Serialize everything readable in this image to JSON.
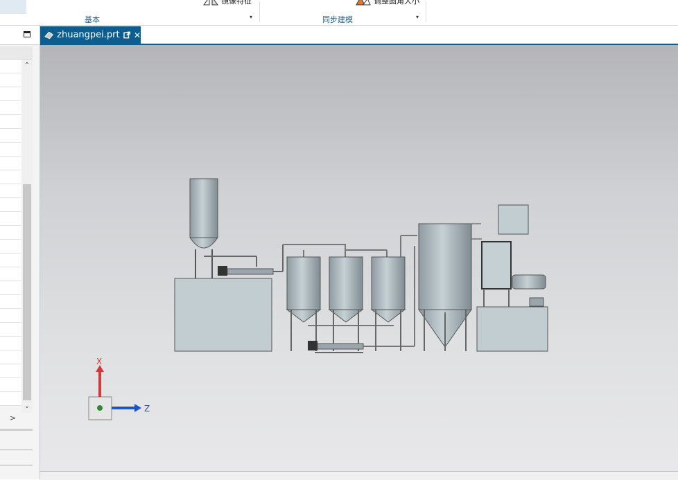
{
  "ribbon": {
    "groups": [
      {
        "label": "基本"
      },
      {
        "label": "同步建模"
      }
    ],
    "buttons": [
      {
        "label": "镜像特征",
        "icon": "mirror-feature-icon"
      },
      {
        "label": "调整圆角大小",
        "icon": "resize-blend-icon"
      }
    ],
    "dropdown_glyph": "▾"
  },
  "left_panel": {
    "scroll_up": "⌃",
    "scroll_down": "⌄",
    "scroll_right": ">"
  },
  "tab": {
    "title": "zhuangpei.prt",
    "close_glyph": "✕"
  },
  "viewport": {
    "axis_x_label": "X",
    "axis_z_label": "Z",
    "colors": {
      "x_axis": "#d33a3a",
      "z_axis": "#1b56c6",
      "tank": "#a7b4b9",
      "base": "#c2cdd2"
    }
  }
}
